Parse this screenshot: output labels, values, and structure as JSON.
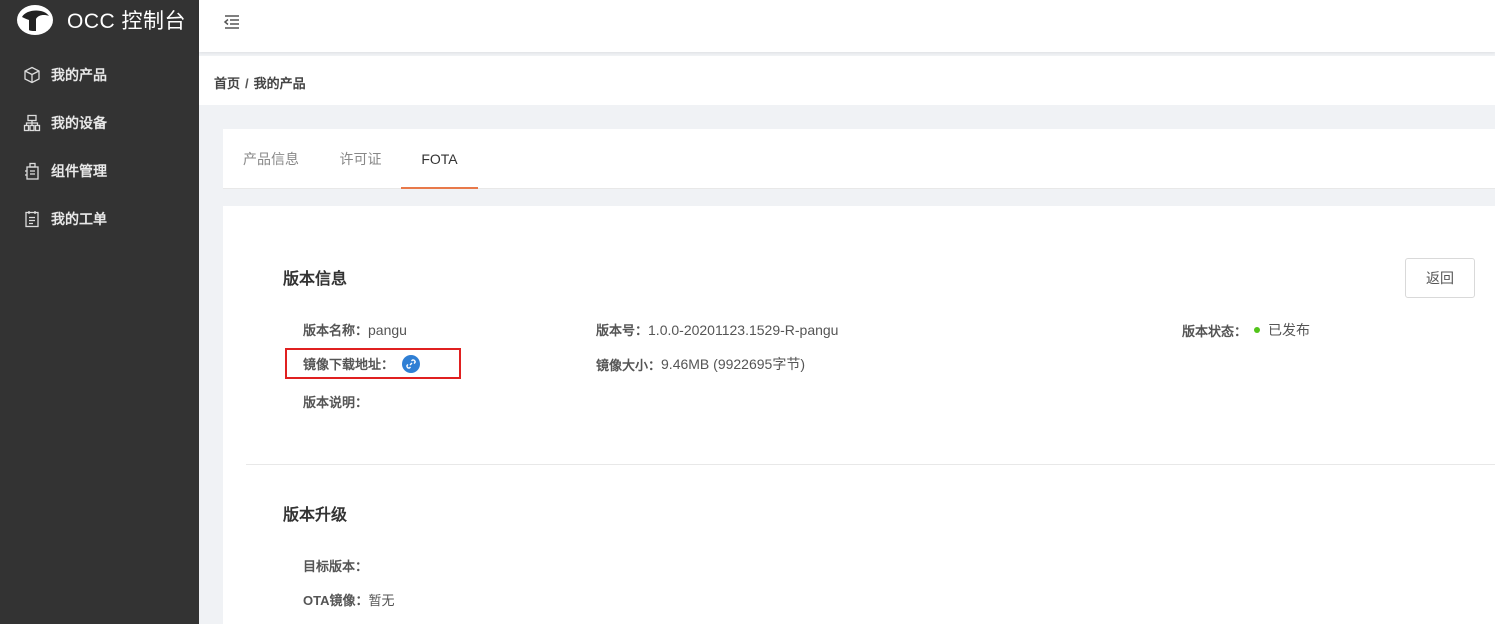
{
  "app": {
    "title": "OCC 控制台"
  },
  "sidebar": {
    "items": [
      {
        "label": "我的产品",
        "icon": "cube-icon"
      },
      {
        "label": "我的设备",
        "icon": "device-tree-icon"
      },
      {
        "label": "组件管理",
        "icon": "component-icon"
      },
      {
        "label": "我的工单",
        "icon": "ticket-icon"
      }
    ]
  },
  "breadcrumb": {
    "home": "首页",
    "separator": "/",
    "current": "我的产品"
  },
  "tabs": [
    {
      "label": "产品信息",
      "active": false
    },
    {
      "label": "许可证",
      "active": false
    },
    {
      "label": "FOTA",
      "active": true
    }
  ],
  "version_info": {
    "title": "版本信息",
    "back_label": "返回",
    "name_key": "版本名称：",
    "name_value": "pangu",
    "number_key": "版本号：",
    "number_value": "1.0.0-20201123.1529-R-pangu",
    "status_key": "版本状态：",
    "status_value": "已发布",
    "status_color": "#52c41a",
    "download_key": "镜像下载地址：",
    "download_icon": "link-icon",
    "size_key": "镜像大小：",
    "size_value": "9.46MB (9922695字节)",
    "desc_key": "版本说明："
  },
  "upgrade": {
    "title": "版本升级",
    "target_key": "目标版本：",
    "ota_key": "OTA镜像：",
    "ota_value": "暂无"
  },
  "colors": {
    "sidebar_bg": "#333333",
    "accent": "#e8794a",
    "highlight": "#e02020",
    "link": "#2f7fd4"
  }
}
